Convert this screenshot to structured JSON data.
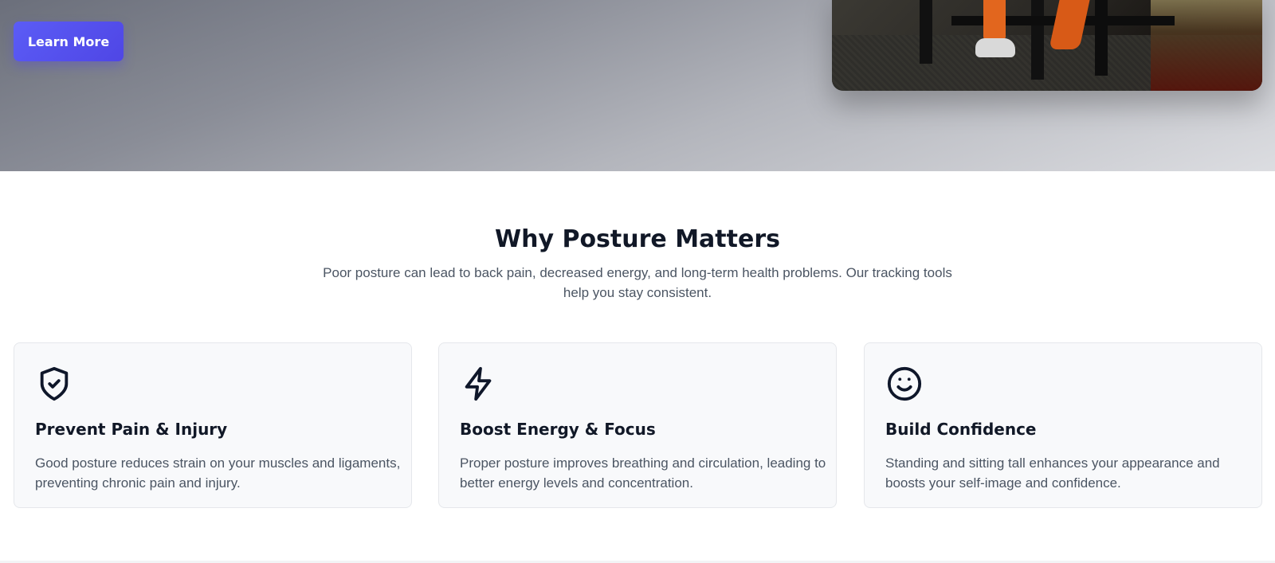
{
  "hero": {
    "cta_label": "Learn More",
    "accent": "#4f46e5",
    "image_icon": "gym-photo"
  },
  "why": {
    "title": "Why Posture Matters",
    "subtitle": "Poor posture can lead to back pain, decreased energy, and long-term health problems. Our tracking tools help you stay consistent."
  },
  "cards": [
    {
      "icon": "shield-check-icon",
      "title": "Prevent Pain & Injury",
      "text": "Good posture reduces strain on your muscles and ligaments, preventing chronic pain and injury."
    },
    {
      "icon": "lightning-icon",
      "title": "Boost Energy & Focus",
      "text": "Proper posture improves breathing and circulation, leading to better energy levels and concentration."
    },
    {
      "icon": "smile-icon",
      "title": "Build Confidence",
      "text": "Standing and sitting tall enhances your appearance and boosts your self-image and confidence."
    }
  ]
}
